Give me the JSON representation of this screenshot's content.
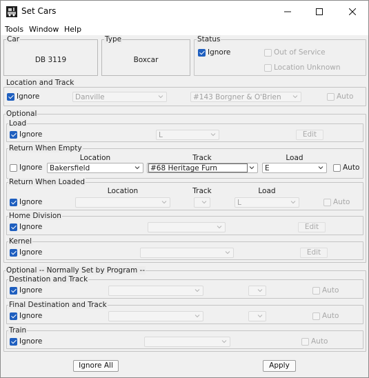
{
  "window": {
    "title": "Set Cars"
  },
  "menu": {
    "items": [
      "Tools",
      "Window",
      "Help"
    ]
  },
  "car": {
    "legend": "Car",
    "value": "DB 3119"
  },
  "type": {
    "legend": "Type",
    "value": "Boxcar"
  },
  "status": {
    "legend": "Status",
    "ignore": "Ignore",
    "out_of_service": "Out of Service",
    "location_unknown": "Location Unknown"
  },
  "location_track": {
    "legend": "Location and Track",
    "ignore": "Ignore",
    "location": "Danville",
    "track": "#143 Borgner & O'Brien",
    "auto": "Auto"
  },
  "optional": {
    "legend": "Optional"
  },
  "load": {
    "legend": "Load",
    "ignore": "Ignore",
    "value": "L",
    "edit": "Edit"
  },
  "return_empty": {
    "legend": "Return When Empty",
    "col_location": "Location",
    "col_track": "Track",
    "col_load": "Load",
    "ignore": "Ignore",
    "location": "Bakersfield",
    "track": "#68 Heritage Furn",
    "load": "E",
    "auto": "Auto"
  },
  "return_loaded": {
    "legend": "Return When Loaded",
    "col_location": "Location",
    "col_track": "Track",
    "col_load": "Load",
    "ignore": "Ignore",
    "load": "L",
    "auto": "Auto"
  },
  "home_division": {
    "legend": "Home Division",
    "ignore": "Ignore",
    "edit": "Edit"
  },
  "kernel": {
    "legend": "Kernel",
    "ignore": "Ignore",
    "edit": "Edit"
  },
  "optional_program": {
    "legend": "Optional -- Normally Set by Program --"
  },
  "destination": {
    "legend": "Destination and Track",
    "ignore": "Ignore",
    "auto": "Auto"
  },
  "final_destination": {
    "legend": "Final Destination and Track",
    "ignore": "Ignore",
    "auto": "Auto"
  },
  "train": {
    "legend": "Train",
    "ignore": "Ignore",
    "auto": "Auto"
  },
  "footer": {
    "ignore_all": "Ignore All",
    "apply": "Apply"
  }
}
